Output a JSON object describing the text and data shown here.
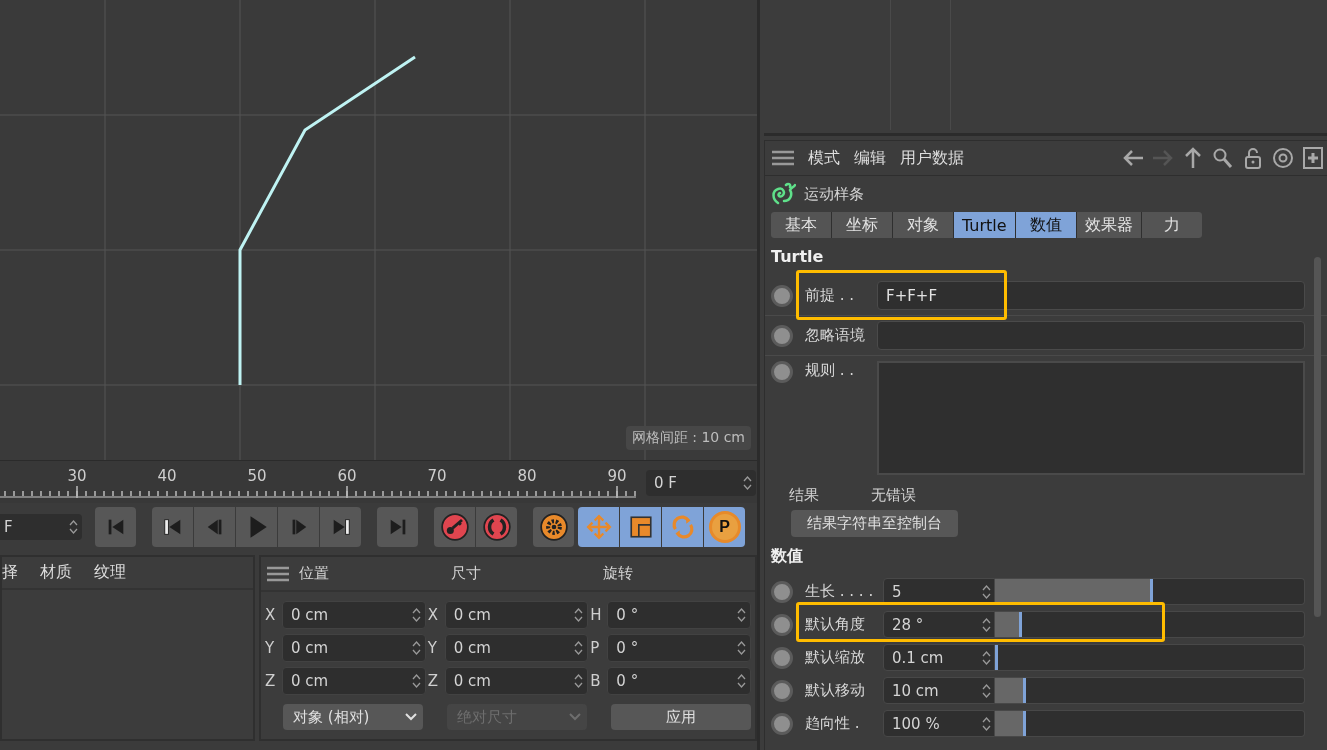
{
  "viewport": {
    "grid_label": "网格间距 : 10 cm"
  },
  "timeline": {
    "ruler_labels": [
      "30",
      "40",
      "50",
      "60",
      "70",
      "80",
      "90"
    ],
    "current_frame": "0 F"
  },
  "transport": {
    "frame_field": "F",
    "key_filters": [
      {
        "kind": "move",
        "on": true
      },
      {
        "kind": "scale",
        "on": true
      },
      {
        "kind": "rotate",
        "on": true
      },
      {
        "kind": "param",
        "on": true,
        "label": "P"
      }
    ]
  },
  "material_panel": {
    "menu": [
      "择",
      "材质",
      "纹理"
    ]
  },
  "coordinates": {
    "columns": [
      {
        "title": "位置",
        "fields": [
          {
            "axis": "X",
            "value": "0 cm"
          },
          {
            "axis": "Y",
            "value": "0 cm"
          },
          {
            "axis": "Z",
            "value": "0 cm"
          }
        ]
      },
      {
        "title": "尺寸",
        "fields": [
          {
            "axis": "X",
            "value": "0 cm"
          },
          {
            "axis": "Y",
            "value": "0 cm"
          },
          {
            "axis": "Z",
            "value": "0 cm"
          }
        ]
      },
      {
        "title": "旋转",
        "fields": [
          {
            "axis": "H",
            "value": "0 °"
          },
          {
            "axis": "P",
            "value": "0 °"
          },
          {
            "axis": "B",
            "value": "0 °"
          }
        ]
      }
    ],
    "mode_dropdown": {
      "value": "对象 (相对)",
      "disabled": false
    },
    "size_dropdown": {
      "value": "绝对尺寸",
      "disabled": true
    },
    "apply_button": "应用"
  },
  "attributes": {
    "menu": [
      "模式",
      "编辑",
      "用户数据"
    ],
    "nav": [
      {
        "kind": "back",
        "disabled": false
      },
      {
        "kind": "forward",
        "disabled": true
      },
      {
        "kind": "up",
        "disabled": false
      },
      {
        "kind": "search",
        "disabled": false
      },
      {
        "kind": "lock",
        "disabled": false
      },
      {
        "kind": "target",
        "disabled": false
      },
      {
        "kind": "new",
        "disabled": false
      }
    ],
    "object_name": "运动样条",
    "tabs": [
      {
        "label": "基本",
        "selected": false
      },
      {
        "label": "坐标",
        "selected": false
      },
      {
        "label": "对象",
        "selected": false
      },
      {
        "label": "Turtle",
        "selected": true
      },
      {
        "label": "数值",
        "selected": true
      },
      {
        "label": "效果器",
        "selected": false
      },
      {
        "label": "力",
        "selected": false
      }
    ],
    "turtle": {
      "title": "Turtle",
      "params": [
        {
          "kind": "text",
          "label": "前提 . .",
          "value": "F+F+F",
          "highlighted": true,
          "keyed": false
        },
        {
          "kind": "text",
          "label": "忽略语境",
          "highlighted": false,
          "keyed": false
        },
        {
          "kind": "textarea",
          "label": "规则 . .",
          "highlighted": false,
          "keyed": false
        }
      ],
      "result_label": "结果",
      "result_value": "无错误",
      "console_button": "结果字符串至控制台"
    },
    "values": {
      "title": "数值",
      "sliders": [
        {
          "label": "生长 . . . .",
          "value": "5",
          "level": 0.5,
          "highlighted": false,
          "keyed": false
        },
        {
          "label": "默认角度",
          "value": "28 °",
          "level": 0.078,
          "highlighted": true,
          "keyed": false
        },
        {
          "label": "默认缩放",
          "value": "0.1 cm",
          "level": 0,
          "highlighted": false,
          "keyed": false
        },
        {
          "label": "默认移动",
          "value": "10 cm",
          "level": 0.09,
          "highlighted": false,
          "keyed": false
        },
        {
          "label": "趋向性 .",
          "value": "100 %",
          "level": 0.09,
          "highlighted": false,
          "keyed": false
        }
      ]
    }
  }
}
